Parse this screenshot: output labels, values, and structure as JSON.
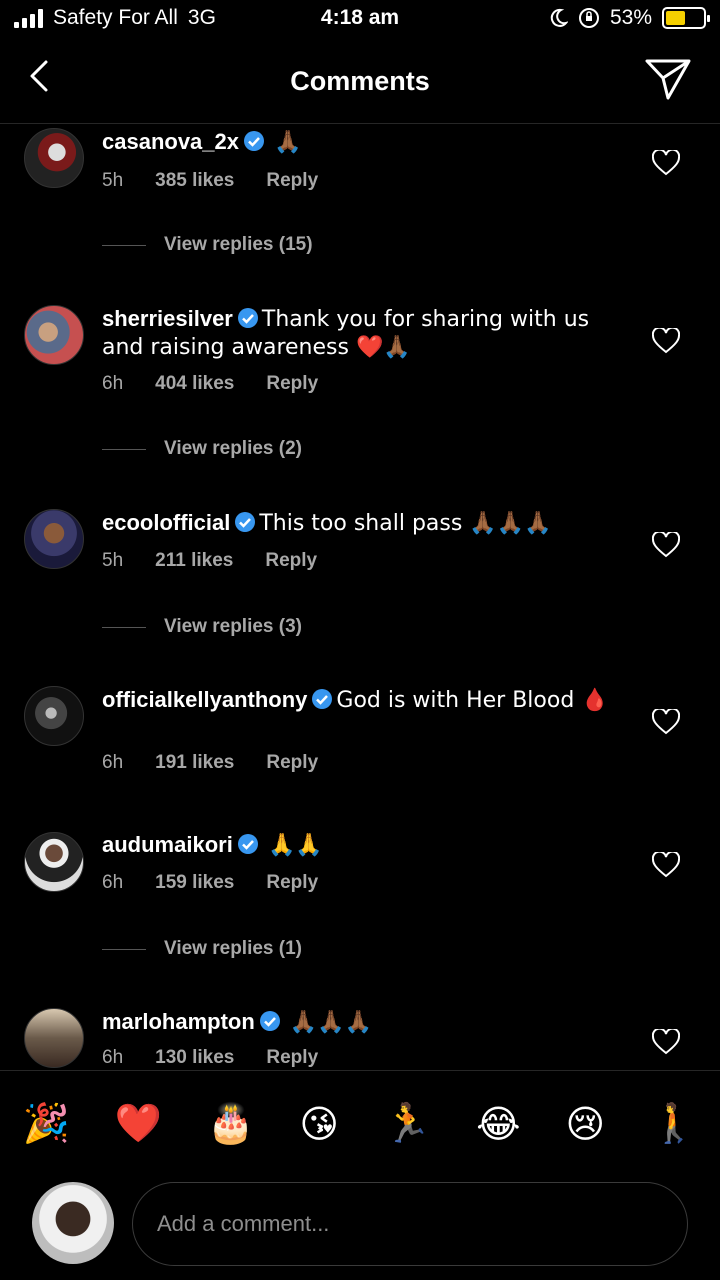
{
  "status_bar": {
    "carrier": "Safety For All",
    "network": "3G",
    "time": "4:18 am",
    "battery": "53%",
    "battery_level": 0.53
  },
  "header": {
    "title": "Comments"
  },
  "comments": [
    {
      "user": "casanova_2x",
      "text": "🙏🏾",
      "time": "5h",
      "likes": "385 likes",
      "reply": "Reply",
      "view_replies": "View replies (15)"
    },
    {
      "user": "sherriesilver",
      "text": "Thank you for sharing with us and raising awareness ❤️🙏🏾",
      "time": "6h",
      "likes": "404 likes",
      "reply": "Reply",
      "view_replies": "View replies (2)"
    },
    {
      "user": "ecoolofficial",
      "text": "This too shall pass 🙏🏾🙏🏾🙏🏾",
      "time": "5h",
      "likes": "211 likes",
      "reply": "Reply",
      "view_replies": "View replies (3)"
    },
    {
      "user": "officialkellyanthony",
      "text": "God is with Her  Blood 🩸",
      "time": "6h",
      "likes": "191 likes",
      "reply": "Reply"
    },
    {
      "user": "audumaikori",
      "text": "🙏🙏",
      "time": "6h",
      "likes": "159 likes",
      "reply": "Reply",
      "view_replies": "View replies (1)"
    },
    {
      "user": "marlohampton",
      "text": "🙏🏾🙏🏾🙏🏾",
      "time": "6h",
      "likes": "130 likes",
      "reply": "Reply"
    }
  ],
  "emoji_bar": [
    "🎉",
    "❤️",
    "🎂",
    "😘",
    "🏃",
    "😂",
    "😢",
    "🚶"
  ],
  "compose": {
    "placeholder": "Add a comment..."
  }
}
